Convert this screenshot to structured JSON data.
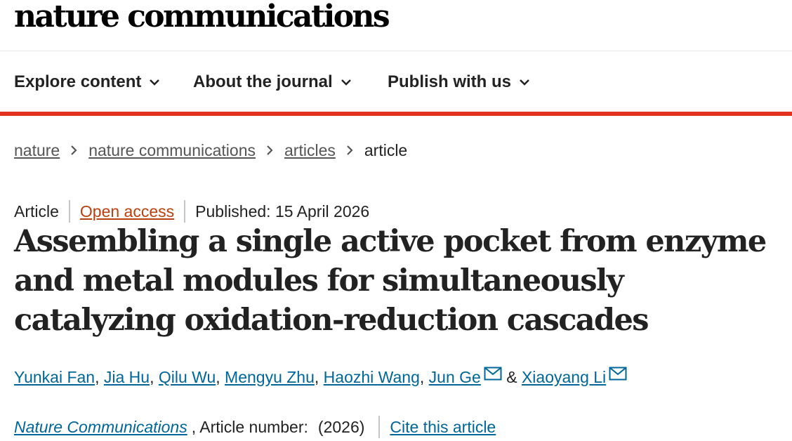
{
  "brand": {
    "name": "nature communications"
  },
  "nav": {
    "items": [
      {
        "label": "Explore content"
      },
      {
        "label": "About the journal"
      },
      {
        "label": "Publish with us"
      }
    ]
  },
  "breadcrumb": {
    "items": [
      "nature",
      "nature communications",
      "articles"
    ],
    "current": "article"
  },
  "article": {
    "type": "Article",
    "access": "Open access",
    "published": "Published: 15 April 2026",
    "title": "Assembling a single active pocket from enzyme and metal modules for simultaneously catalyzing oxidation-reduction cascades",
    "authors": [
      {
        "name": "Yunkai Fan",
        "sep": ","
      },
      {
        "name": "Jia Hu",
        "sep": ","
      },
      {
        "name": "Qilu Wu",
        "sep": ","
      },
      {
        "name": "Mengyu Zhu",
        "sep": ","
      },
      {
        "name": "Haozhi Wang",
        "sep": ","
      },
      {
        "name": "Jun Ge",
        "sep": ""
      },
      {
        "name": "Xiaoyang Li",
        "sep": ""
      }
    ],
    "ampersand": "&",
    "journal": "Nature Communications",
    "article_number": ", Article number:",
    "year": "(2026)",
    "cite": "Cite this article"
  },
  "colors": {
    "accent_red": "#e0301e",
    "link_blue": "#006699",
    "open_access": "#b8410f",
    "text": "#222222"
  },
  "icons": {
    "chevron": "chevron-down-icon",
    "separator": "chevron-right-icon",
    "mail": "mail-icon"
  }
}
